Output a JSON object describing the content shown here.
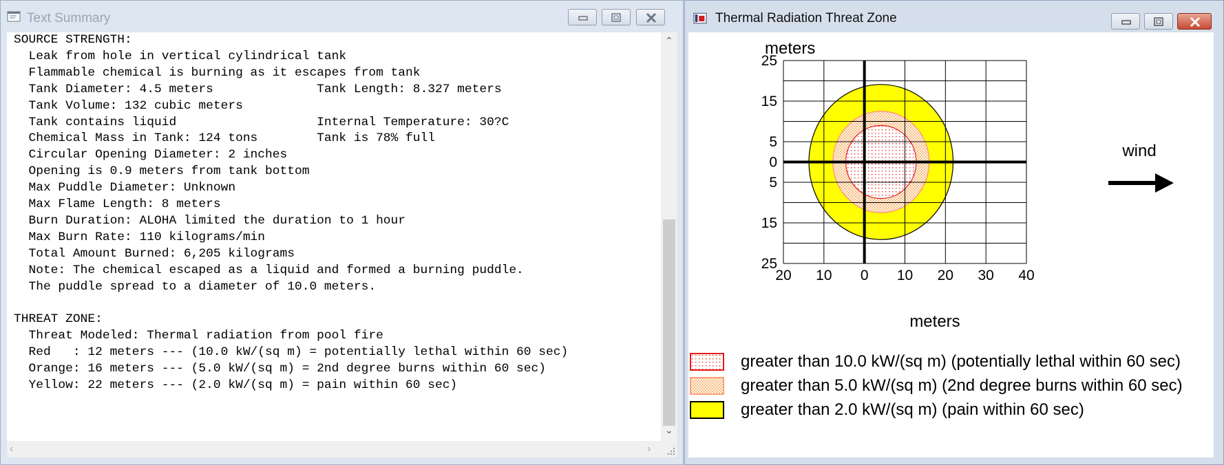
{
  "left_window": {
    "title": "Text Summary",
    "lines": [
      "SOURCE STRENGTH:",
      "  Leak from hole in vertical cylindrical tank",
      "  Flammable chemical is burning as it escapes from tank",
      "  Tank Diameter: 4.5 meters              Tank Length: 8.327 meters",
      "  Tank Volume: 132 cubic meters",
      "  Tank contains liquid                   Internal Temperature: 30?C",
      "  Chemical Mass in Tank: 124 tons        Tank is 78% full",
      "  Circular Opening Diameter: 2 inches",
      "  Opening is 0.9 meters from tank bottom",
      "  Max Puddle Diameter: Unknown",
      "  Max Flame Length: 8 meters",
      "  Burn Duration: ALOHA limited the duration to 1 hour",
      "  Max Burn Rate: 110 kilograms/min",
      "  Total Amount Burned: 6,205 kilograms",
      "  Note: The chemical escaped as a liquid and formed a burning puddle.",
      "  The puddle spread to a diameter of 10.0 meters.",
      "",
      "THREAT ZONE:",
      "  Threat Modeled: Thermal radiation from pool fire",
      "  Red   : 12 meters --- (10.0 kW/(sq m) = potentially lethal within 60 sec)",
      "  Orange: 16 meters --- (5.0 kW/(sq m) = 2nd degree burns within 60 sec)",
      "  Yellow: 22 meters --- (2.0 kW/(sq m) = pain within 60 sec)"
    ]
  },
  "right_window": {
    "title": "Thermal Radiation Threat Zone",
    "wind_label": "wind"
  },
  "chart_data": {
    "type": "threat-zone-plot",
    "xlabel": "meters",
    "ylabel": "meters",
    "x_ticks": [
      "20",
      "10",
      "0",
      "10",
      "20",
      "30",
      "40"
    ],
    "y_ticks": [
      "25",
      "15",
      "5",
      "0",
      "5",
      "15",
      "25"
    ],
    "xlim": [
      -20,
      40
    ],
    "ylim": [
      -25,
      25
    ],
    "x_grid_step": 10,
    "y_grid_step": 5,
    "zones": [
      {
        "name": "yellow",
        "distance_m": 22,
        "color": "#ffff00",
        "stroke": "#000000",
        "center_x": 4.1,
        "semi_x": 17.8,
        "semi_y": 19.1,
        "legend": "greater than 2.0 kW/(sq m) (pain within 60 sec)"
      },
      {
        "name": "orange",
        "distance_m": 16,
        "color": "#ffcc99",
        "stroke": "#ff8c7a",
        "center_x": 4.1,
        "semi_x": 11.9,
        "semi_y": 12.5,
        "legend": "greater than 5.0 kW/(sq m) (2nd degree burns within 60 sec)"
      },
      {
        "name": "red",
        "distance_m": 12,
        "color": "#ff7777",
        "stroke": "#e81818",
        "center_x": 4.1,
        "semi_x": 8.7,
        "semi_y": 9.0,
        "legend": "greater than 10.0 kW/(sq m) (potentially lethal within 60 sec)"
      }
    ]
  }
}
